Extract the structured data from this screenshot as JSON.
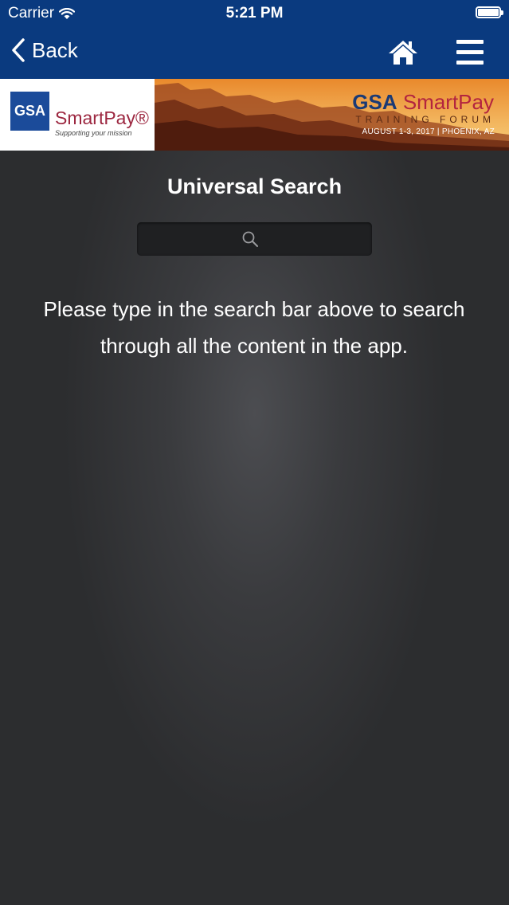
{
  "status_bar": {
    "carrier": "Carrier",
    "time": "5:21 PM",
    "wifi_icon": "wifi-icon",
    "battery_icon": "battery-icon"
  },
  "nav": {
    "back_label": "Back",
    "back_icon": "chevron-left-icon",
    "home_icon": "home-icon",
    "menu_icon": "hamburger-menu-icon",
    "bar_color": "#0a3a7f"
  },
  "banner": {
    "logo_badge": "GSA",
    "logo_name": "SmartPay®",
    "logo_tagline": "Supporting your mission",
    "event_org": "GSA",
    "event_name": "SmartPay",
    "event_sub": "TRAINING FORUM",
    "event_date": "AUGUST 1-3, 2017 | PHOENIX, AZ"
  },
  "main": {
    "title": "Universal Search",
    "search": {
      "value": "",
      "placeholder": "",
      "icon": "search-icon"
    },
    "message": "Please type in the search bar above to search through all the content in the app."
  }
}
